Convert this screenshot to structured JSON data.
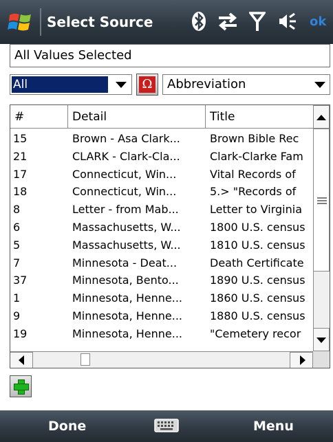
{
  "titlebar": {
    "title": "Select Source",
    "ok_label": "ok",
    "icons": [
      "windows-start-icon",
      "bluetooth-icon",
      "sync-arrows-icon",
      "signal-antenna-icon",
      "speaker-icon"
    ]
  },
  "filter": {
    "value": "All Values Selected"
  },
  "category": {
    "selected": "All"
  },
  "sort": {
    "selected": "Abbreviation"
  },
  "list": {
    "columns": [
      "#",
      "Detail",
      "Title"
    ],
    "rows": [
      {
        "num": "15",
        "detail": "Brown - Asa Clark...",
        "title": "Brown Bible Rec"
      },
      {
        "num": "21",
        "detail": "CLARK - Clark-Cla...",
        "title": "Clark-Clarke Fam"
      },
      {
        "num": "17",
        "detail": "Connecticut, Win...",
        "title": "Vital Records of"
      },
      {
        "num": "18",
        "detail": "Connecticut, Win...",
        "title": "5.> \"Records of"
      },
      {
        "num": "8",
        "detail": "Letter - from Mab...",
        "title": "Letter to Virginia"
      },
      {
        "num": "6",
        "detail": "Massachusetts, W...",
        "title": "1800 U.S. census"
      },
      {
        "num": "5",
        "detail": "Massachusetts, W...",
        "title": "1810 U.S. census"
      },
      {
        "num": "7",
        "detail": "Minnesota - Deat...",
        "title": "Death Certificate"
      },
      {
        "num": "37",
        "detail": "Minnesota, Bento...",
        "title": "1890 U.S. census"
      },
      {
        "num": "1",
        "detail": "Minnesota, Henne...",
        "title": "1860 U.S. census"
      },
      {
        "num": "9",
        "detail": "Minnesota, Henne...",
        "title": "1880 U.S. census"
      },
      {
        "num": "19",
        "detail": "Minnesota, Henne...",
        "title": "\"Cemetery recor"
      }
    ]
  },
  "softkeys": {
    "left": "Done",
    "right": "Menu",
    "center_icon": "keyboard-icon"
  },
  "colors": {
    "titlebar": "#2f3943",
    "ok": "#2f84d8",
    "selection": "#0a246a",
    "omega": "#c81e1e",
    "plus": "#1eb41e"
  }
}
